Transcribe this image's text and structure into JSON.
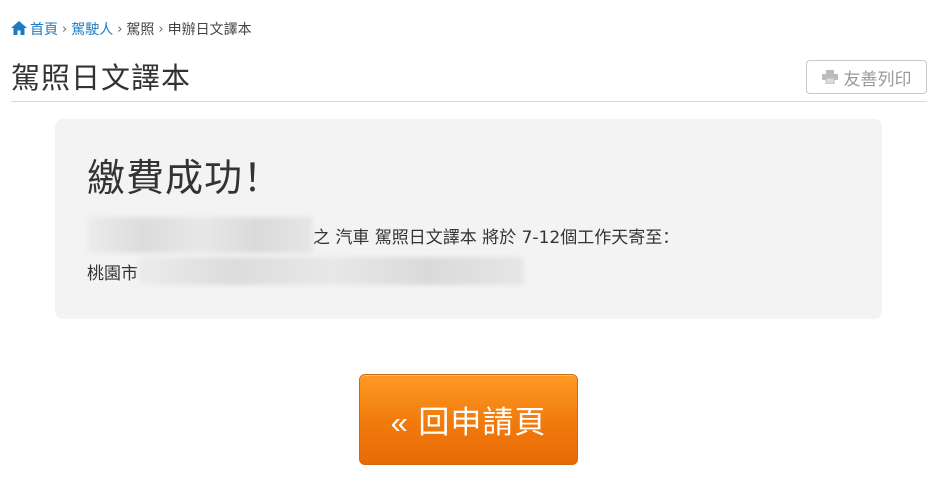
{
  "breadcrumb": {
    "home": "首頁",
    "drivers": "駕駛人",
    "license": "駕照",
    "current": "申辦日文譯本",
    "separator": "›"
  },
  "page": {
    "title": "駕照日文譯本",
    "print_label": "友善列印"
  },
  "result": {
    "heading": "繳費成功！",
    "message": "之 汽車 駕照日文譯本 將於 7-12個工作天寄至：",
    "address_prefix": "桃園市"
  },
  "actions": {
    "back_label": "« 回申請頁"
  },
  "colors": {
    "link": "#1f7bbf",
    "button_orange": "#f07a0c",
    "panel_bg": "#f3f3f3"
  },
  "icons": {
    "home": "home-icon",
    "print": "print-icon"
  }
}
